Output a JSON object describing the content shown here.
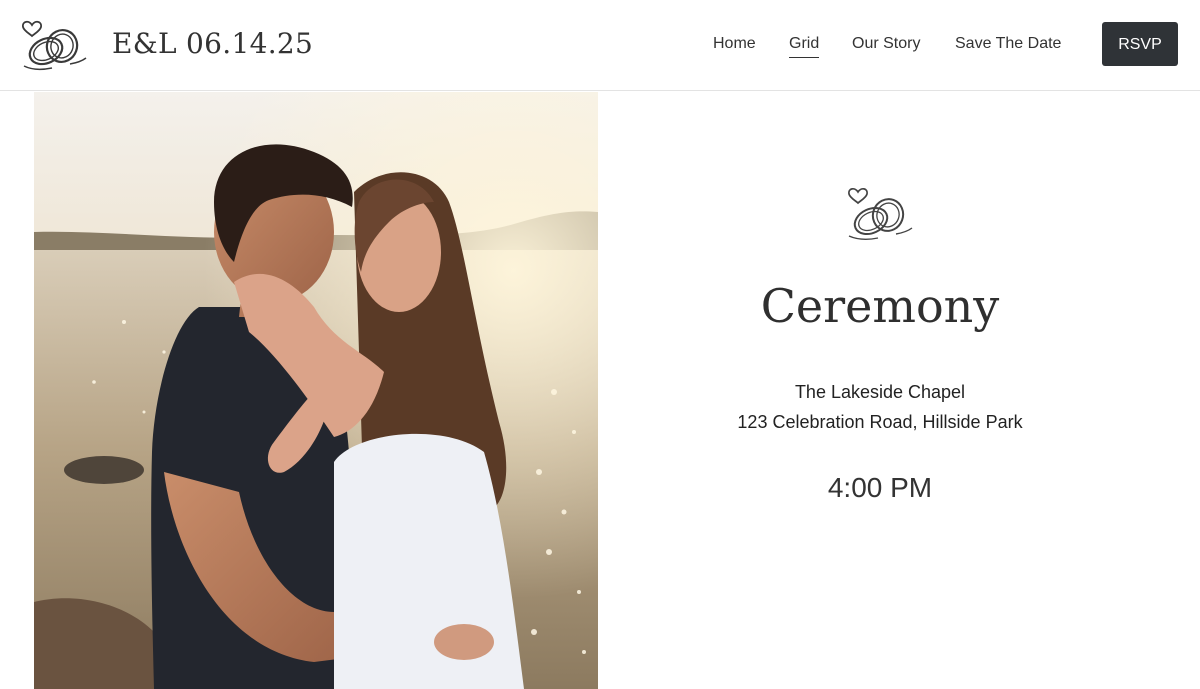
{
  "header": {
    "brand": "E&L 06.14.25",
    "logo_icon": "wedding-rings-heart-icon",
    "nav": [
      {
        "label": "Home",
        "active": false
      },
      {
        "label": "Grid",
        "active": true
      },
      {
        "label": "Our Story",
        "active": false
      },
      {
        "label": "Save The Date",
        "active": false
      }
    ],
    "rsvp_label": "RSVP"
  },
  "photo": {
    "subject": "couple-embracing-at-lakeside-sunset"
  },
  "ceremony": {
    "icon": "wedding-rings-heart-icon",
    "title": "Ceremony",
    "venue_name": "The Lakeside Chapel",
    "venue_address": "123 Celebration Road, Hillside Park",
    "time": "4:00 PM"
  },
  "colors": {
    "button_bg": "#2f3337",
    "text": "#2b2b2b",
    "divider": "#e3e3e3"
  }
}
